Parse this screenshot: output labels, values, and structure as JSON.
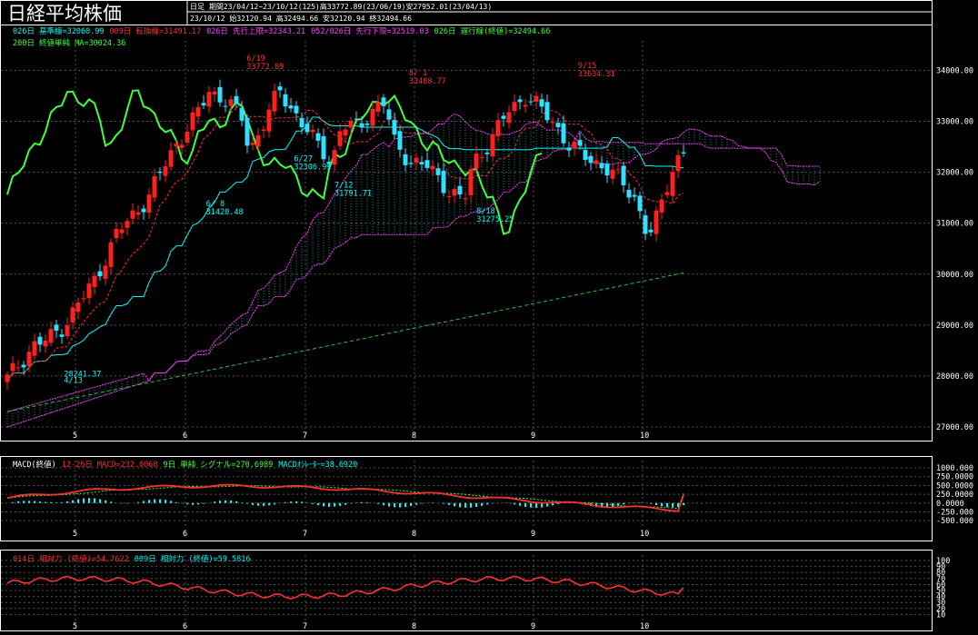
{
  "header": {
    "title": "日経平均株価",
    "period_type": "日足",
    "period_info": "期間23/04/12~23/10/12(125)高33772.89(23/06/19)安27952.01(23/04/13)",
    "last_date": "23/10/12",
    "ohlc": "始32120.94 高32494.66 安32120.94 終32494.66"
  },
  "legend": {
    "line1": [
      {
        "text": "026日 基準線=32060.99",
        "color": "#00ffff"
      },
      {
        "text": "009日 転換線=31491.17",
        "color": "#ff3030"
      },
      {
        "text": "026日 先行上限=32343.21",
        "color": "#ff40ff"
      },
      {
        "text": "052/026日 先行下限=32519.03",
        "color": "#ff40ff"
      },
      {
        "text": "026日 遅行線(終値)=32494.66",
        "color": "#40ff40"
      }
    ],
    "line2": [
      {
        "text": "200日 終値単純 MA=30024.36",
        "color": "#40ff40"
      }
    ]
  },
  "macd_legend": [
    {
      "text": "MACD(終値)",
      "color": "#ffffff"
    },
    {
      "text": "12-26日 MACD=232.0068",
      "color": "#ff3030"
    },
    {
      "text": "9日 単純 シグナル=270.6989",
      "color": "#40ff40"
    },
    {
      "text": "MACDｵｼﾚｰﾀｰ=38.6920",
      "color": "#00ffff"
    }
  ],
  "rsi_legend": [
    {
      "text": "014日 相対力 (終値)=54.7622",
      "color": "#ff3030"
    },
    {
      "text": "009日 相対力 (終値)=59.5816",
      "color": "#00ffff"
    }
  ],
  "chart_data": {
    "type": "candlestick",
    "x_labels": [
      "5",
      "6",
      "7",
      "8",
      "9",
      "10"
    ],
    "main_y_ticks": [
      "34000.00",
      "33000.00",
      "32000.00",
      "31000.00",
      "30000.00",
      "29000.00",
      "28000.00",
      "27000.00"
    ],
    "main_ylim": [
      27000,
      34400
    ],
    "macd_y_ticks": [
      "1000.000",
      "750.0000",
      "500.0000",
      "250.0000",
      "0.0000",
      "-250.000",
      "-500.000"
    ],
    "macd_ylim": [
      -600,
      1000
    ],
    "rsi_y_ticks": [
      "100",
      "90",
      "80",
      "70",
      "60",
      "50",
      "40",
      "30",
      "20",
      "10"
    ],
    "rsi_ylim": [
      0,
      100
    ],
    "annotations": [
      {
        "text": "4/13",
        "value": 27952,
        "color": "#00ffff"
      },
      {
        "text": "28241.37",
        "value": 28241.37,
        "color": "#00ffff"
      },
      {
        "text": "6/19",
        "value": 33772.89,
        "color": "#ff3030"
      },
      {
        "text": "33772.89",
        "value": 33772.89,
        "color": "#ff3030"
      },
      {
        "text": "6/ 8",
        "value": 31420.48,
        "color": "#00ffff"
      },
      {
        "text": "31420.48",
        "value": 31420.48,
        "color": "#00ffff"
      },
      {
        "text": "6/27",
        "value": 32306.99,
        "color": "#00ffff"
      },
      {
        "text": "32306.99",
        "value": 32306.99,
        "color": "#00ffff"
      },
      {
        "text": "7/12",
        "value": 31791.71,
        "color": "#00ffff"
      },
      {
        "text": "31791.71",
        "value": 31791.71,
        "color": "#00ffff"
      },
      {
        "text": "8/ 1",
        "value": 33488.77,
        "color": "#ff3030"
      },
      {
        "text": "33488.77",
        "value": 33488.77,
        "color": "#ff3030"
      },
      {
        "text": "8/18",
        "value": 31275.25,
        "color": "#00ffff"
      },
      {
        "text": "31275.25",
        "value": 31275.25,
        "color": "#00ffff"
      },
      {
        "text": "9/15",
        "value": 33634.31,
        "color": "#ff3030"
      },
      {
        "text": "33634.31",
        "value": 33634.31,
        "color": "#ff3030"
      }
    ]
  }
}
